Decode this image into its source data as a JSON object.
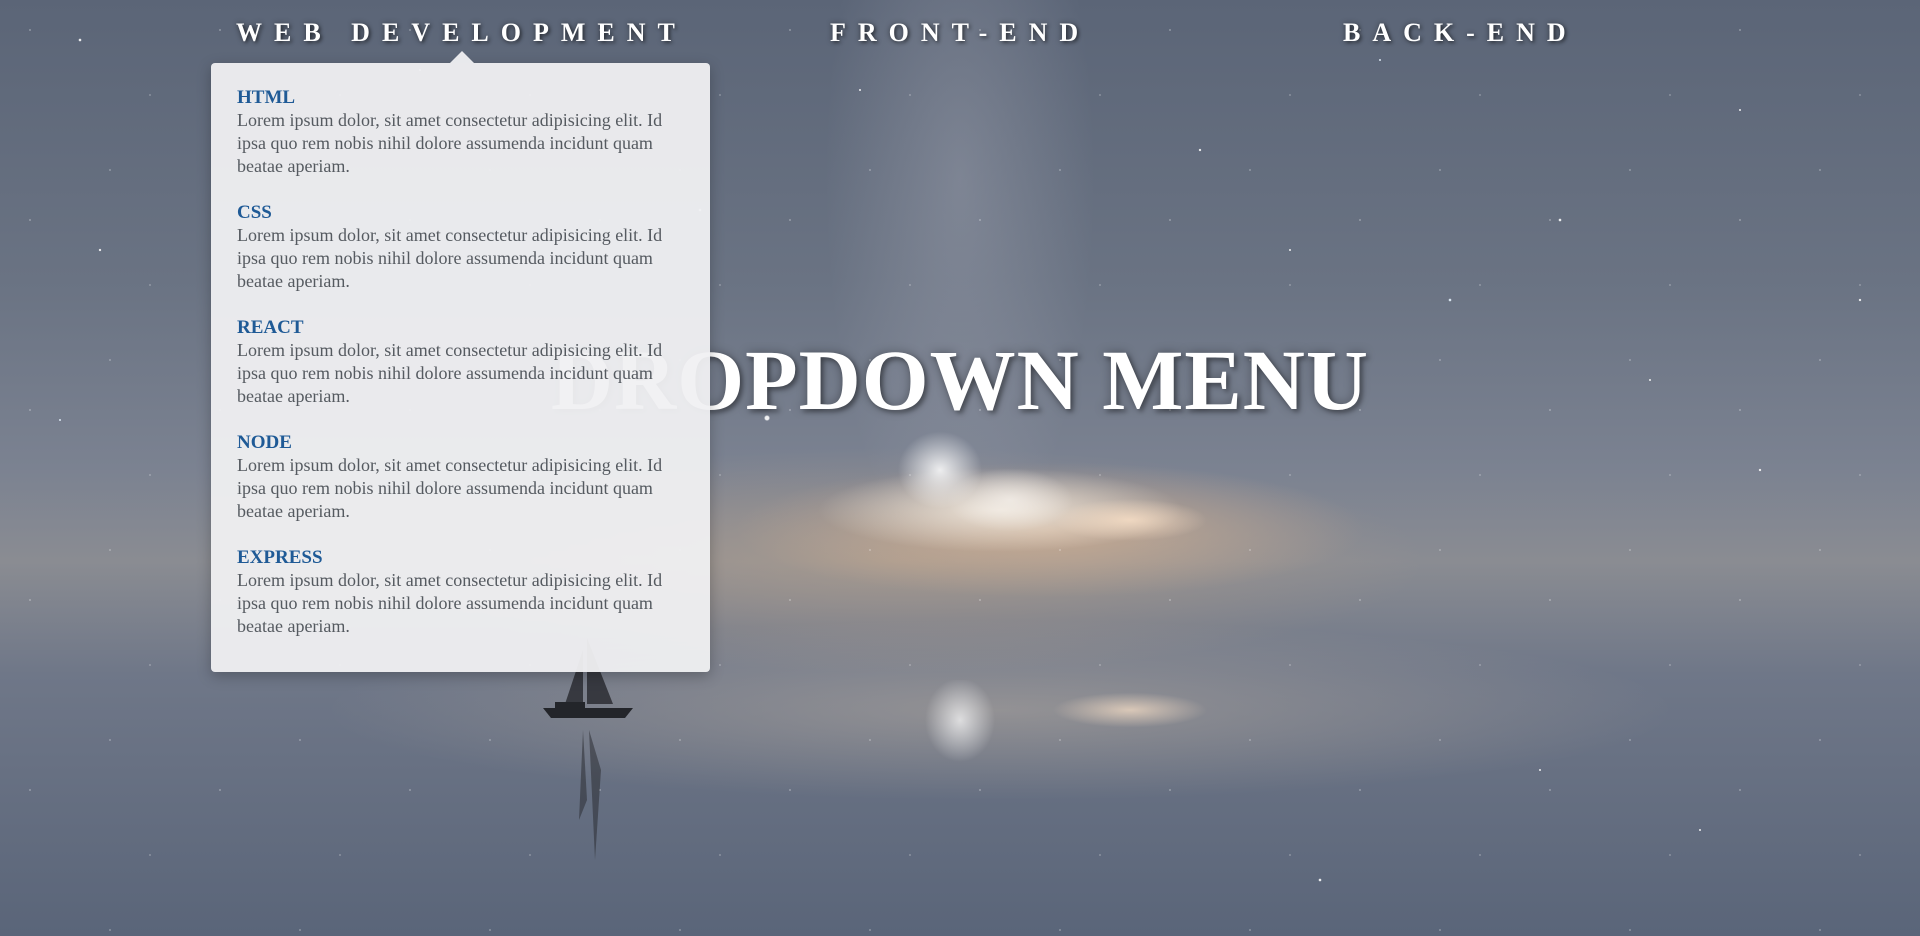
{
  "nav": {
    "items": [
      {
        "label": "WEB DEVELOPMENT"
      },
      {
        "label": "FRONT-END"
      },
      {
        "label": "BACK-END"
      }
    ]
  },
  "headline": "DROPDOWN MENU",
  "dropdown": {
    "items": [
      {
        "title": "HTML",
        "description": "Lorem ipsum dolor, sit amet consectetur adipisicing elit. Id ipsa quo rem nobis nihil dolore assumenda incidunt quam beatae aperiam."
      },
      {
        "title": "CSS",
        "description": "Lorem ipsum dolor, sit amet consectetur adipisicing elit. Id ipsa quo rem nobis nihil dolore assumenda incidunt quam beatae aperiam."
      },
      {
        "title": "REACT",
        "description": "Lorem ipsum dolor, sit amet consectetur adipisicing elit. Id ipsa quo rem nobis nihil dolore assumenda incidunt quam beatae aperiam."
      },
      {
        "title": "NODE",
        "description": "Lorem ipsum dolor, sit amet consectetur adipisicing elit. Id ipsa quo rem nobis nihil dolore assumenda incidunt quam beatae aperiam."
      },
      {
        "title": "EXPRESS",
        "description": "Lorem ipsum dolor, sit amet consectetur adipisicing elit. Id ipsa quo rem nobis nihil dolore assumenda incidunt quam beatae aperiam."
      }
    ]
  },
  "colors": {
    "nav_text": "#ffffff",
    "dropdown_bg": "#f0f0f2",
    "item_title": "#1f5a96",
    "item_text": "#555a60"
  }
}
